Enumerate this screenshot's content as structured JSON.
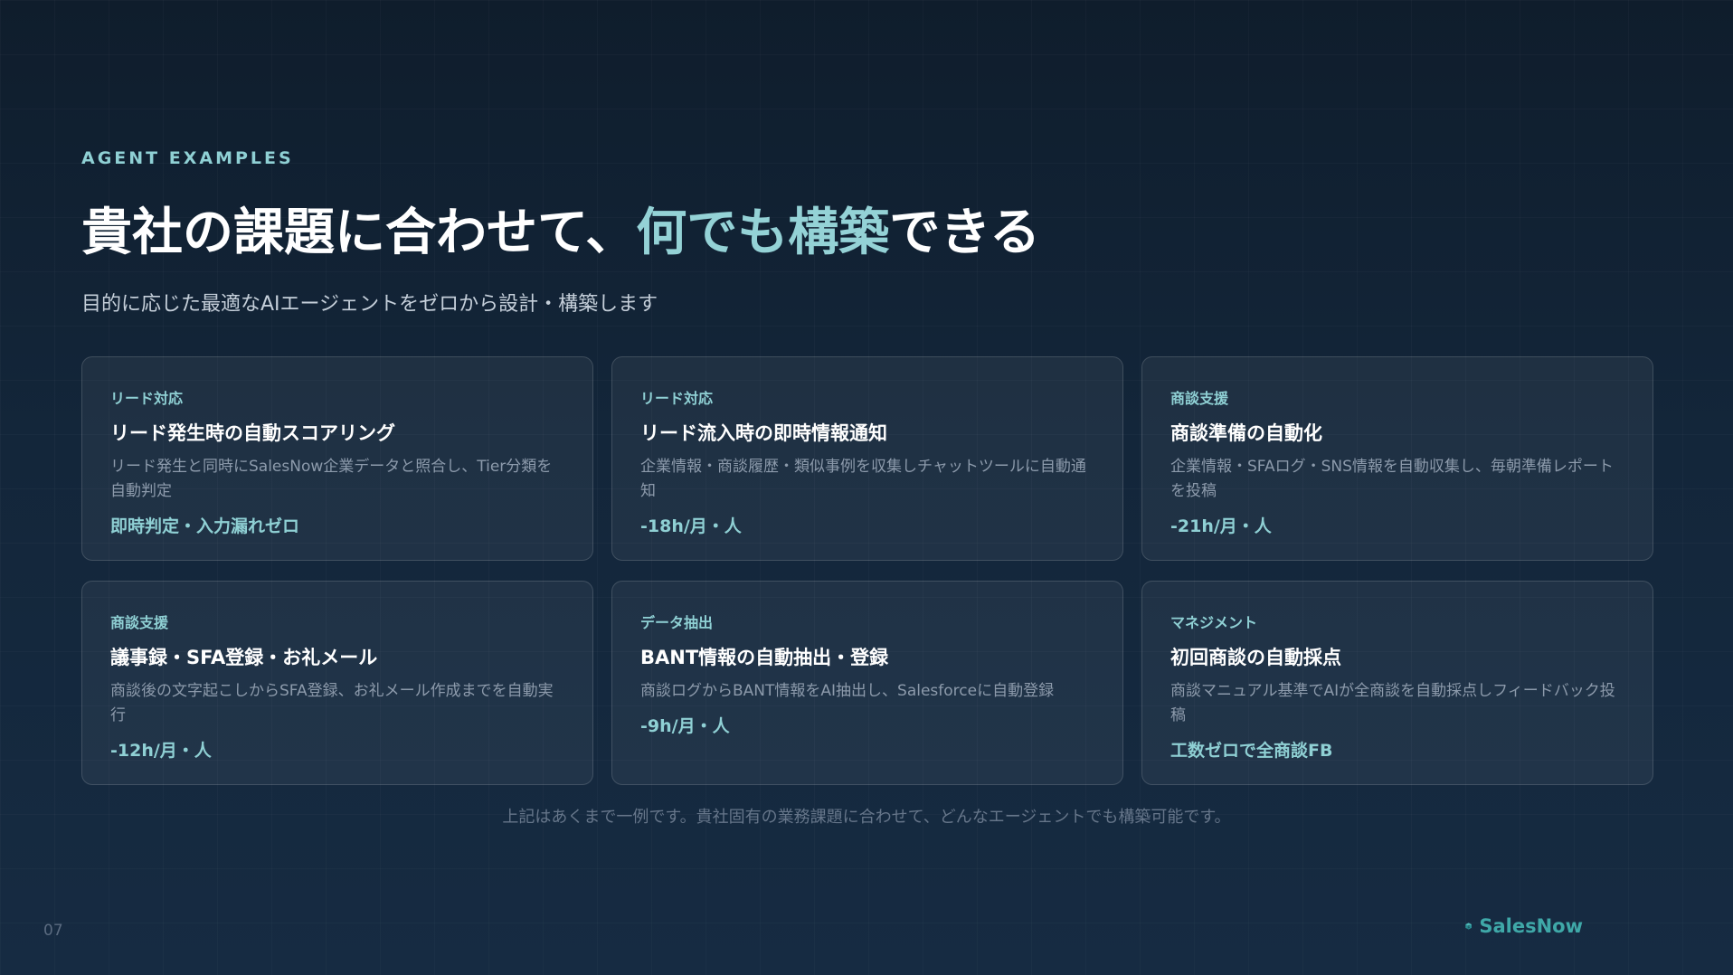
{
  "slide": {
    "eyebrow": "AGENT EXAMPLES",
    "title_main": "貴社の課題に合わせて、",
    "title_accent": "何でも構築",
    "title_tail": "できる",
    "subtitle": "目的に応じた最適なAIエージェントをゼロから設計・構築します",
    "footnote": "上記はあくまで一例です。貴社固有の業務課題に合わせて、どんなエージェントでも構築可能です。",
    "page_number": "07",
    "brand": "SalesNow"
  },
  "cards": [
    {
      "tag": "リード対応",
      "title": "リード発生時の自動スコアリング",
      "description": "リード発生と同時にSalesNow企業データと照合し、Tier分類を自動判定",
      "metric": "即時判定・入力漏れゼロ"
    },
    {
      "tag": "リード対応",
      "title": "リード流入時の即時情報通知",
      "description": "企業情報・商談履歴・類似事例を収集しチャットツールに自動通知",
      "metric": "-18h/月・人"
    },
    {
      "tag": "商談支援",
      "title": "商談準備の自動化",
      "description": "企業情報・SFAログ・SNS情報を自動収集し、毎朝準備レポートを投稿",
      "metric": "-21h/月・人"
    },
    {
      "tag": "商談支援",
      "title": "議事録・SFA登録・お礼メール",
      "description": "商談後の文字起こしからSFA登録、お礼メール作成までを自動実行",
      "metric": "-12h/月・人"
    },
    {
      "tag": "データ抽出",
      "title": "BANT情報の自動抽出・登録",
      "description": "商談ログからBANT情報をAI抽出し、Salesforceに自動登録",
      "metric": "-9h/月・人"
    },
    {
      "tag": "マネジメント",
      "title": "初回商談の自動採点",
      "description": "商談マニュアル基準でAIが全商談を自動採点しフィードバック投稿",
      "metric": "工数ゼロで全商談FB"
    }
  ],
  "colors": {
    "accent": "#94d2d6",
    "brand": "#3fa8a8"
  },
  "icons": {
    "brand_logo": "salesnow-logo-icon"
  }
}
